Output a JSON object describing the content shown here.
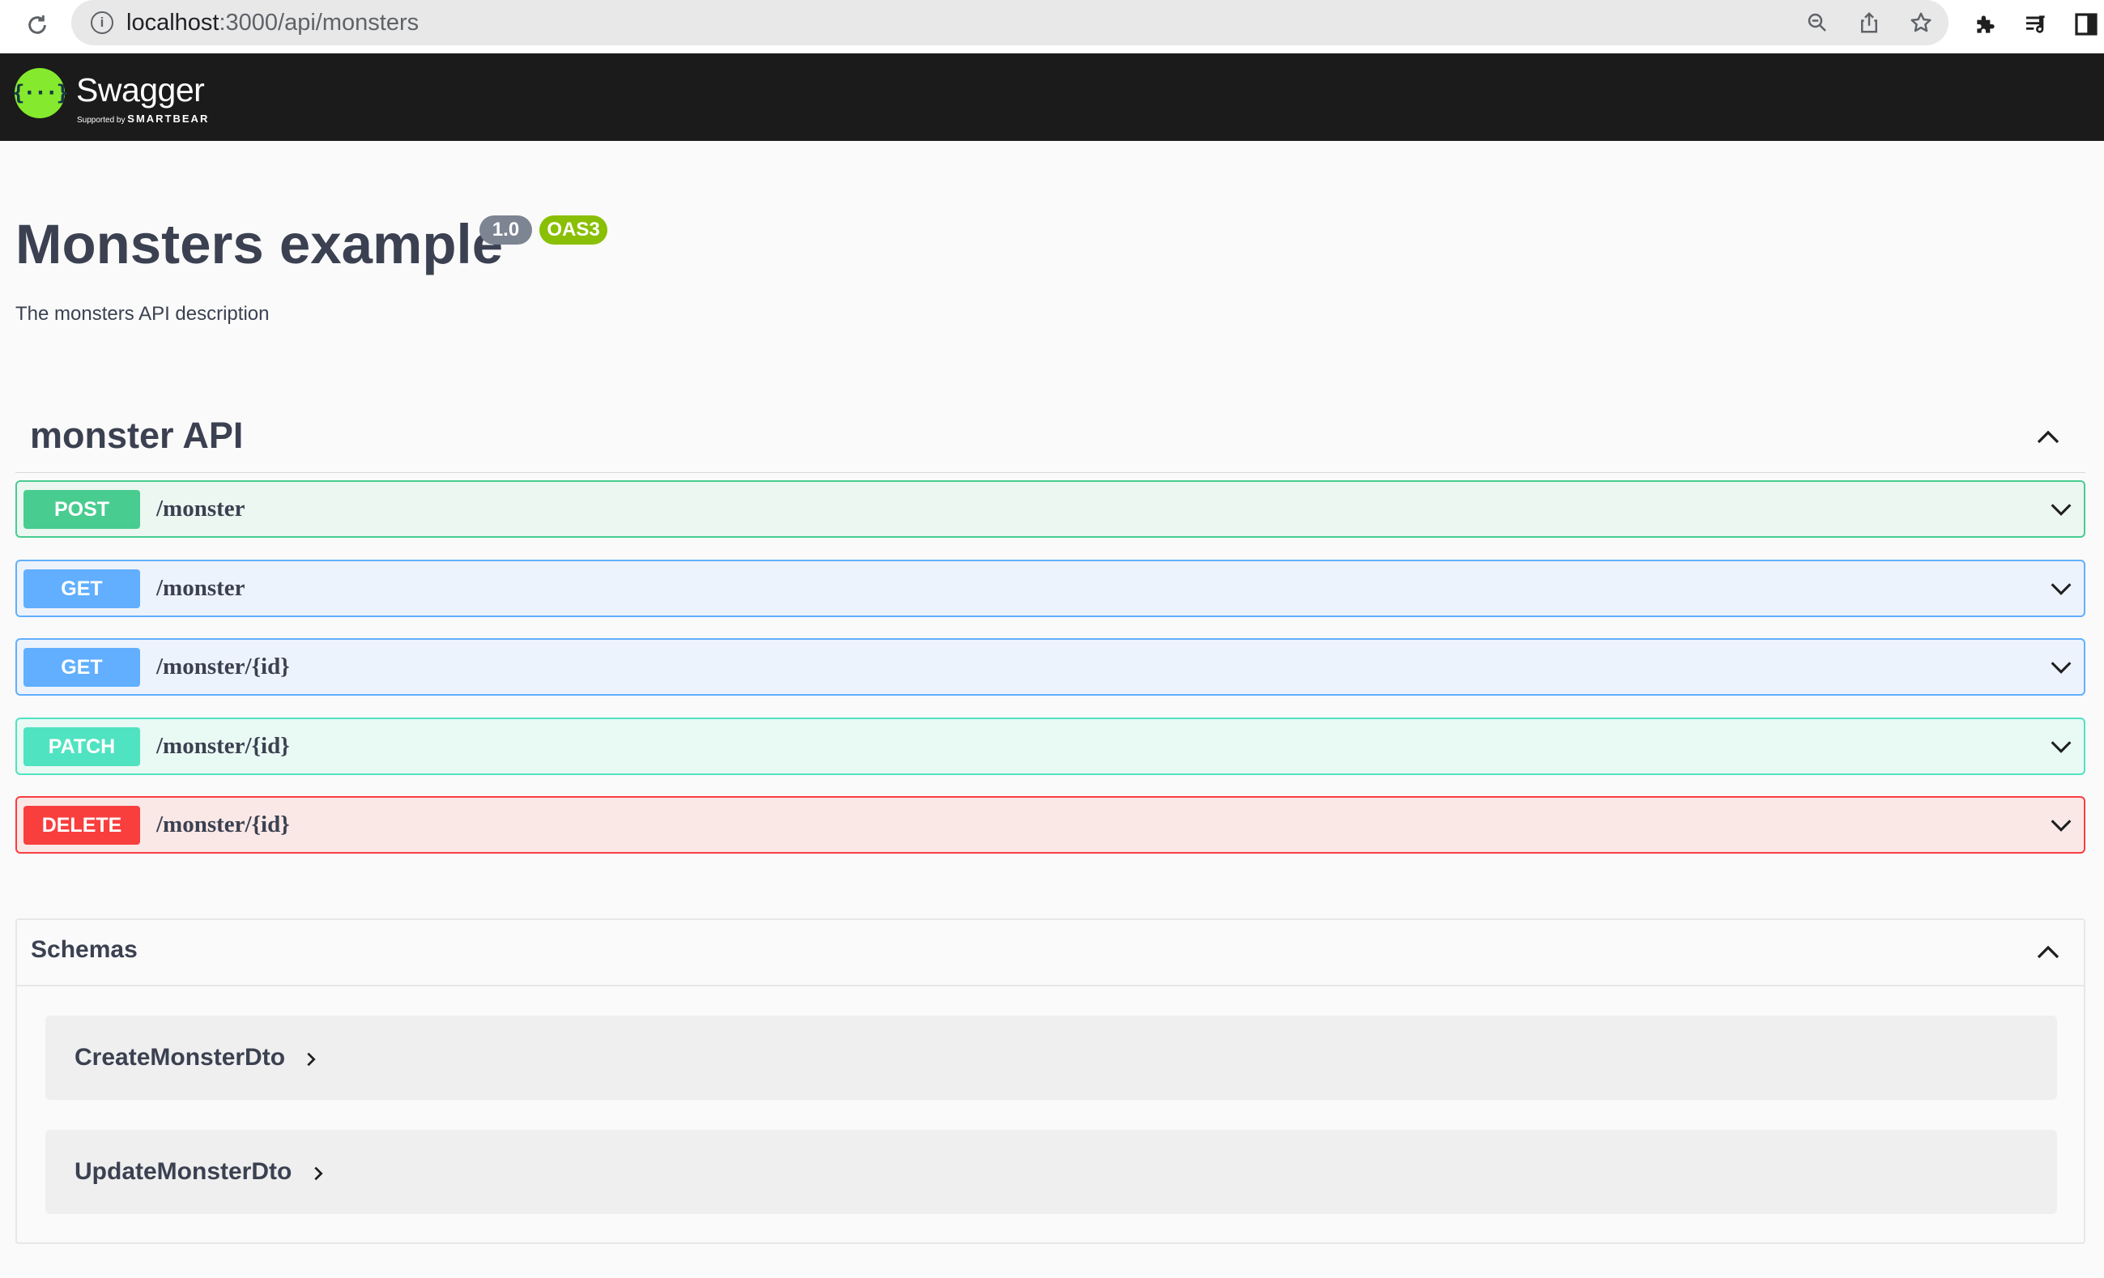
{
  "browser": {
    "url_host": "localhost",
    "url_rest": ":3000/api/monsters",
    "icons": [
      "reload-icon",
      "info-icon",
      "zoom-icon",
      "share-icon",
      "bookmark-star-icon",
      "extensions-puzzle-icon",
      "reading-list-icon",
      "side-panel-icon"
    ]
  },
  "topbar": {
    "logo_glyph": "{···}",
    "logo_name": "Swagger",
    "logo_sub_small": "Supported by",
    "logo_sub_brand": "SMARTBEAR"
  },
  "info": {
    "title": "Monsters example",
    "version": "1.0",
    "oas": "OAS3",
    "description": "The monsters API description"
  },
  "tag": {
    "name": "monster API",
    "operations": [
      {
        "method": "POST",
        "path": "/monster",
        "color": "#49cc90"
      },
      {
        "method": "GET",
        "path": "/monster",
        "color": "#61affe"
      },
      {
        "method": "GET",
        "path": "/monster/{id}",
        "color": "#61affe"
      },
      {
        "method": "PATCH",
        "path": "/monster/{id}",
        "color": "#50e3c2"
      },
      {
        "method": "DELETE",
        "path": "/monster/{id}",
        "color": "#f93e3e"
      }
    ]
  },
  "schemas": {
    "title": "Schemas",
    "models": [
      {
        "name": "CreateMonsterDto"
      },
      {
        "name": "UpdateMonsterDto"
      }
    ]
  },
  "colors": {
    "topbar_bg": "#1b1b1b",
    "logo_green": "#85ea2d",
    "text": "#3b4151"
  }
}
